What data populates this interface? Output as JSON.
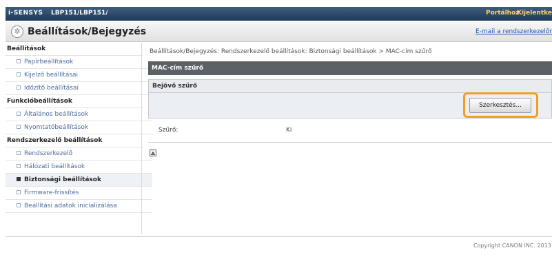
{
  "topbar": {
    "brand": "i-SENSYS",
    "model": "LBP151/LBP151/",
    "portal": "Portálhoz",
    "logout": "Kijelentkezé"
  },
  "header": {
    "title": "Beállítások/Bejegyzés",
    "email_link": "E-mail a rendszerkezelőnek"
  },
  "sidebar": {
    "items": [
      {
        "label": "Beállítások",
        "type": "head"
      },
      {
        "label": "Papírbeállítások",
        "type": "sub"
      },
      {
        "label": "Kijelző beállításai",
        "type": "sub"
      },
      {
        "label": "Időzítő beállításai",
        "type": "sub"
      },
      {
        "label": "Funkcióbeállítások",
        "type": "head"
      },
      {
        "label": "Általános beállítások",
        "type": "sub"
      },
      {
        "label": "Nyomtatóbeállítások",
        "type": "sub"
      },
      {
        "label": "Rendszerkezelő beállítások",
        "type": "head"
      },
      {
        "label": "Rendszerkezelő",
        "type": "sub"
      },
      {
        "label": "Hálózati beállítások",
        "type": "sub"
      },
      {
        "label": "Biztonsági beállítások",
        "type": "sub",
        "active": true
      },
      {
        "label": "Firmware-frissítés",
        "type": "sub"
      },
      {
        "label": "Beállítási adatok inicializálása",
        "type": "sub"
      }
    ]
  },
  "main": {
    "breadcrumb": "Beállítások/Bejegyzés: Rendszerkezelő beállítások: Biztonsági beállítások > MAC-cím szűrő",
    "section_title": "MAC-cím szűrő",
    "subsection_title": "Bejövő szűrő",
    "edit_button": "Szerkesztés...",
    "filter_label": "Szűrő:",
    "filter_value": "Ki"
  },
  "footer": {
    "copyright": "Copyright CANON INC. 2013"
  },
  "colors": {
    "topbar": "#1f3a59",
    "highlight": "#f0a020",
    "section_header": "#5c6166"
  }
}
